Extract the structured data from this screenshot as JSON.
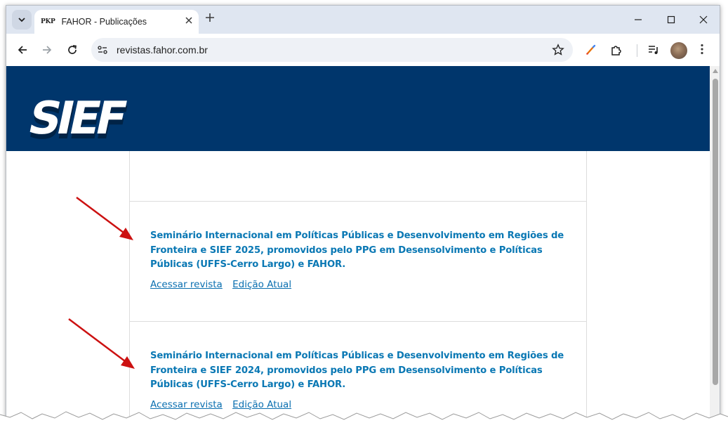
{
  "browser": {
    "tab_favicon": "PKP",
    "tab_title": "FAHOR - Publicações",
    "url": "revistas.fahor.com.br",
    "icons": [
      "chevron-down-icon",
      "close-icon",
      "plus-icon",
      "minimize-icon",
      "maximize-icon",
      "close-window-icon",
      "back-icon",
      "forward-icon",
      "reload-icon",
      "site-info-icon",
      "star-icon",
      "pen-icon",
      "extensions-icon",
      "media-icon",
      "profile-avatar",
      "menu-icon"
    ]
  },
  "site": {
    "logo_text": "SIEF",
    "header_color": "#00366c",
    "link_color": "#0a78b4",
    "arrow_color": "#cc1111"
  },
  "journals": [
    {
      "title": "Seminário Internacional em Políticas Públicas e Desenvolvimento em Regiões de Fronteira e SIEF 2025, promovidos pelo PPG em Desensolvimento e Políticas Públicas (UFFS-Cerro Largo) e FAHOR.",
      "link_access": "Acessar revista",
      "link_current": "Edição Atual"
    },
    {
      "title": "Seminário Internacional em Políticas Públicas e Desenvolvimento em Regiões de Fronteira e SIEF 2024, promovidos pelo PPG em Desensolvimento e Políticas Públicas (UFFS-Cerro Largo) e FAHOR.",
      "link_access": "Acessar revista",
      "link_current": "Edição Atual"
    }
  ]
}
